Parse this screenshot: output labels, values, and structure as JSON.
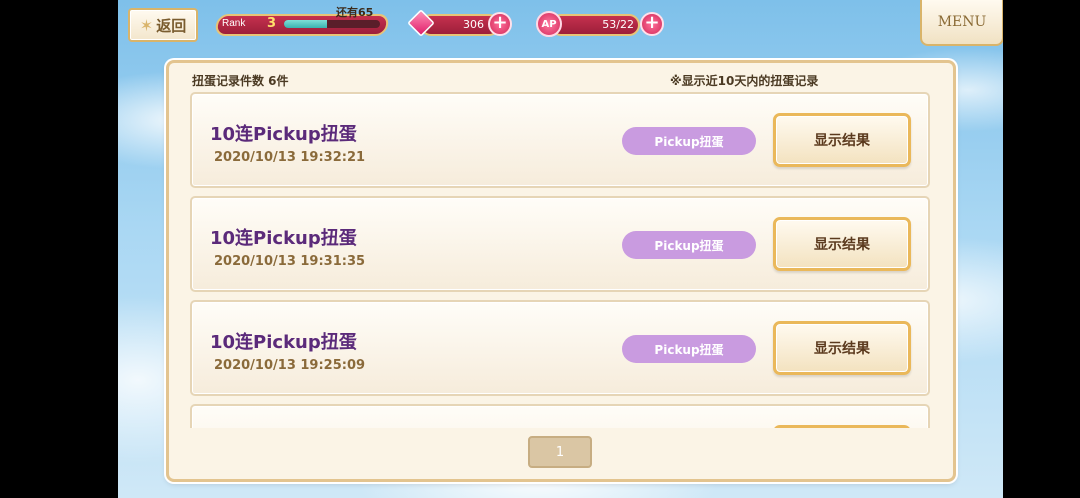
{
  "topbar": {
    "back_label": "返回",
    "rank_label": "Rank",
    "rank_value": "3",
    "rank_remaining": "还有65",
    "rank_progress_fraction": 0.45,
    "gems": "306",
    "ap_icon_text": "AP",
    "ap": "53/22",
    "menu_label": "MENU"
  },
  "header": {
    "count_label": "扭蛋记录件数 6件",
    "note": "※显示近10天内的扭蛋记录"
  },
  "records": [
    {
      "title": "10连Pickup扭蛋",
      "time": "2020/10/13  19:32:21",
      "badge": "Pickup扭蛋",
      "button": "显示结果"
    },
    {
      "title": "10连Pickup扭蛋",
      "time": "2020/10/13  19:31:35",
      "badge": "Pickup扭蛋",
      "button": "显示结果"
    },
    {
      "title": "10连Pickup扭蛋",
      "time": "2020/10/13  19:25:09",
      "badge": "Pickup扭蛋",
      "button": "显示结果"
    }
  ],
  "pager": {
    "current_page": "1"
  },
  "colors": {
    "accent_gold": "#e8c477",
    "badge_purple": "#c99be0",
    "title_purple": "#5b2a7a",
    "bar_red": "#c5304e"
  }
}
